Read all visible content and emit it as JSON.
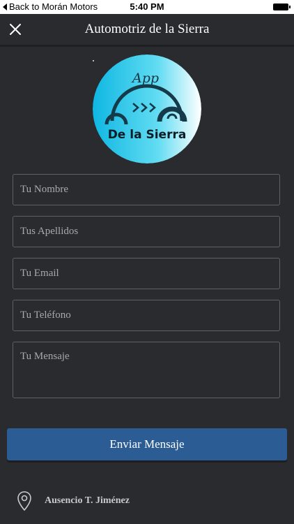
{
  "status_bar": {
    "back_label": "Back to Morán Motors",
    "time": "5:40 PM"
  },
  "nav": {
    "title": "Automotriz de la Sierra"
  },
  "logo": {
    "app_text": "App",
    "brand_text": "De la Sierra"
  },
  "form": {
    "name_placeholder": "Tu Nombre",
    "surname_placeholder": "Tus Apellidos",
    "email_placeholder": "Tu Email",
    "phone_placeholder": "Tu Teléfono",
    "message_placeholder": "Tu Mensaje",
    "submit_label": "Enviar Mensaje"
  },
  "address": {
    "text": "Ausencio T. Jiménez"
  },
  "icons": {
    "close": "close-icon",
    "pin": "location-pin-icon",
    "battery": "battery-icon",
    "back": "back-arrow-icon"
  },
  "colors": {
    "background": "#2a2b2f",
    "button": "#2b5d94",
    "logo_cyan": "#19c5e8"
  }
}
